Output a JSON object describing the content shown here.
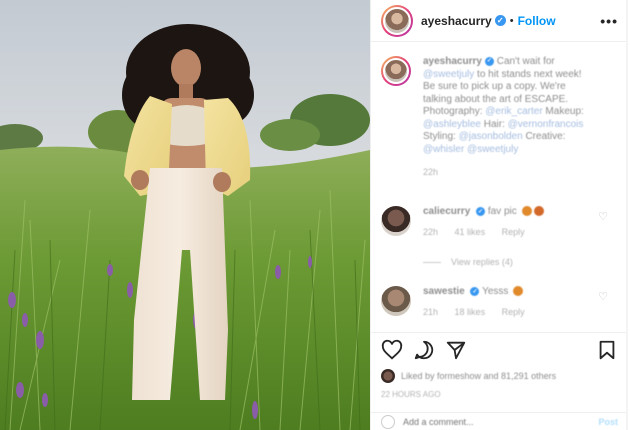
{
  "header": {
    "username": "ayeshacurry",
    "separator": "•",
    "follow_label": "Follow",
    "more_icon": "•••"
  },
  "caption": {
    "username": "ayeshacurry",
    "text_1": " Can't wait for ",
    "mention_1": "@sweetjuly",
    "text_2": " to hit stands next week! Be sure to pick up a copy. We're talking about the art of ESCAPE. Photography: ",
    "mention_2": "@erik_carter",
    "text_3": " Makeup: ",
    "mention_3": "@ashleyblee",
    "text_4": " Hair: ",
    "mention_4": "@vernonfrancois",
    "text_5": " Styling: ",
    "mention_5": "@jasonbolden",
    "text_6": " Creative: ",
    "mention_6": "@whisler @sweetjuly",
    "time": "22h"
  },
  "comments": [
    {
      "username": "caliecurry",
      "text": "fav pic",
      "time": "22h",
      "likes": "41 likes",
      "reply": "Reply",
      "view_replies": "View replies (4)"
    },
    {
      "username": "sawestie",
      "text": "Yesss",
      "time": "21h",
      "likes": "18 likes",
      "reply": "Reply"
    }
  ],
  "actions": {
    "liked_by": "Liked by formeshow and 81,291 others",
    "time_ago": "22 HOURS AGO"
  },
  "add_comment": {
    "placeholder": "Add a comment...",
    "post_label": "Post"
  },
  "colors": {
    "accent": "#0095f6",
    "verified": "#3897f0"
  }
}
